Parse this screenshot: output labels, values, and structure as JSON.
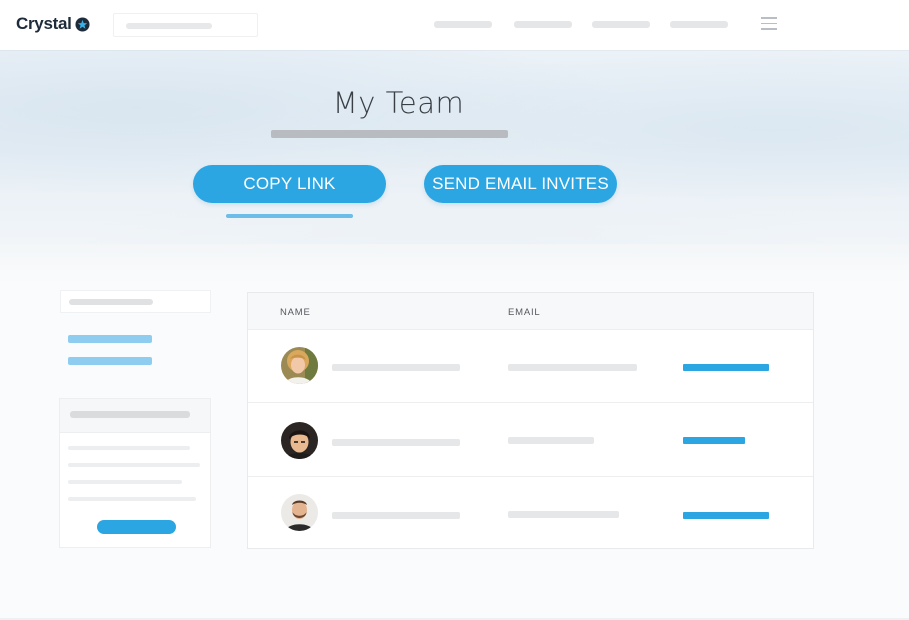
{
  "app": {
    "brand": "Crystal",
    "logo_icon": "crystal-logo-icon",
    "accent_color": "#2ba6e3"
  },
  "header": {
    "menu_icon": "hamburger-menu-icon"
  },
  "hero": {
    "title": "My Team",
    "copy_link_label": "COPY LINK",
    "send_invites_label": "SEND EMAIL INVITES"
  },
  "table": {
    "columns": [
      "NAME",
      "EMAIL"
    ],
    "rows": [
      {
        "avatar": "avatar-woman-blonde"
      },
      {
        "avatar": "avatar-man-dark-hair"
      },
      {
        "avatar": "avatar-man-beard"
      }
    ]
  }
}
